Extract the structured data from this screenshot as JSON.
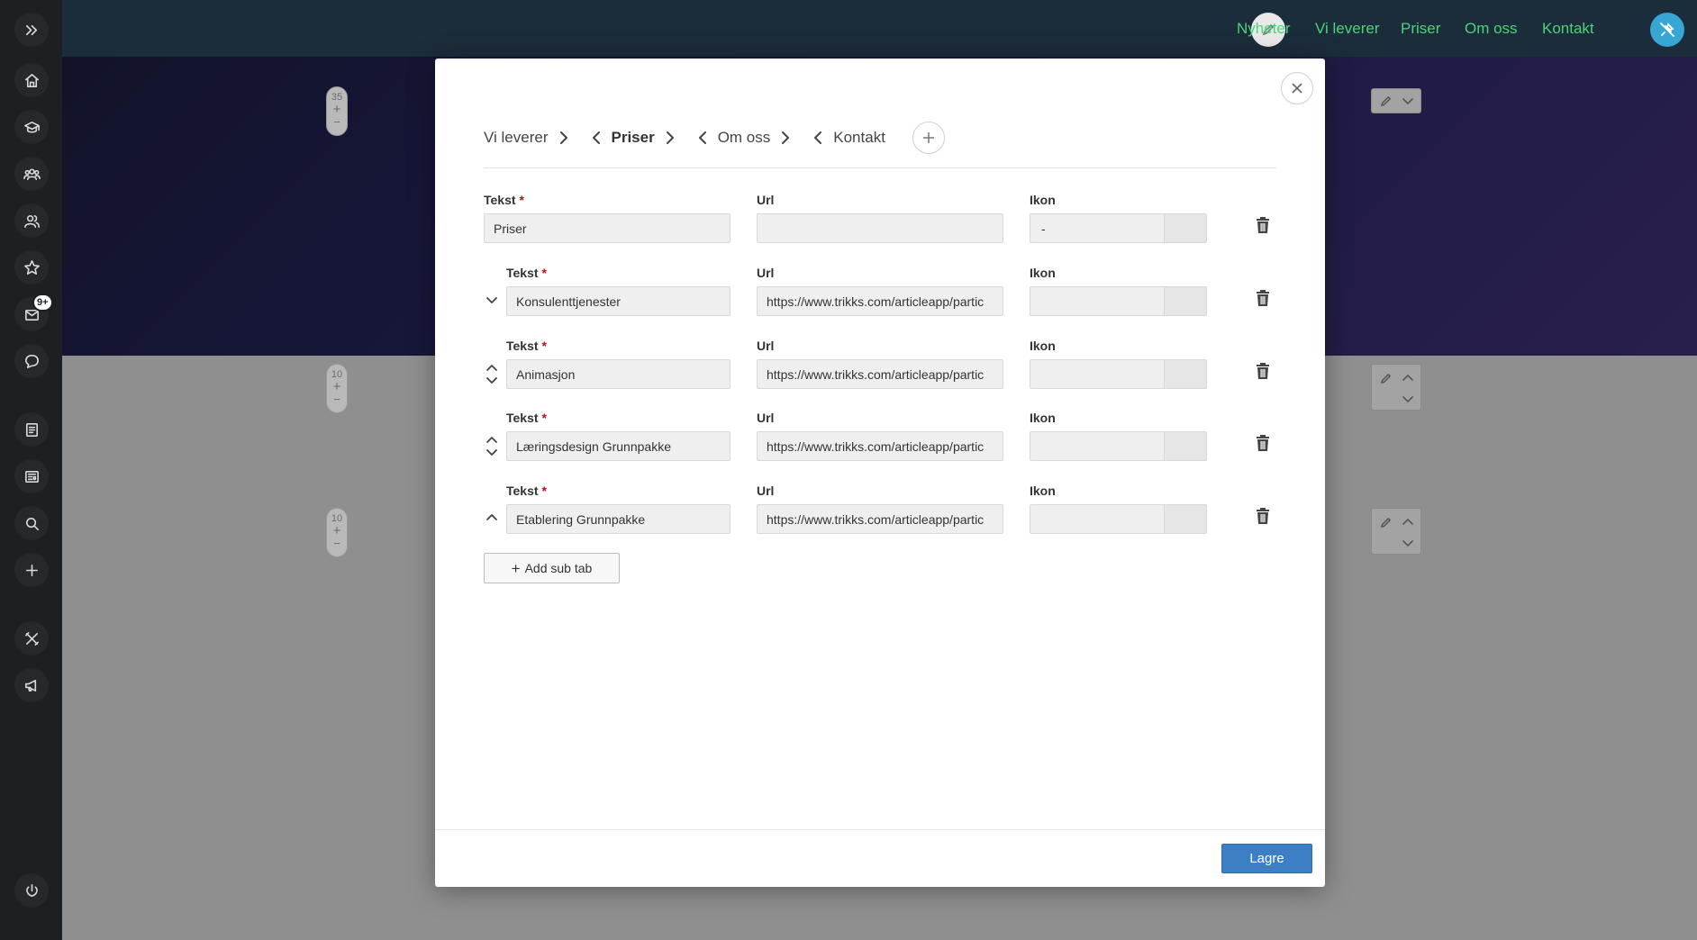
{
  "sidebar": {
    "icons": [
      "expand-icon",
      "home-icon",
      "graduation-cap-icon",
      "group-icon",
      "users-icon",
      "star-icon",
      "mail-icon",
      "chat-icon",
      "document-icon",
      "newspaper-icon",
      "search-icon",
      "plus-icon",
      "tools-icon",
      "megaphone-icon",
      "power-icon"
    ],
    "mail_badge": "9+"
  },
  "topbar": {
    "nav": [
      "Nyheter",
      "Vi leverer",
      "Priser",
      "Om oss",
      "Kontakt"
    ],
    "nav_color": "#4cd37a",
    "pin_color": "#37a6d4"
  },
  "background": {
    "row_controls": [
      {
        "value": "35",
        "plus": "+",
        "minus": "−"
      },
      {
        "value": "10",
        "plus": "+",
        "minus": "−"
      },
      {
        "value": "10",
        "plus": "+",
        "minus": "−"
      }
    ]
  },
  "modal": {
    "tabs": [
      {
        "label": "Vi leverer",
        "left_arrow": false,
        "right_arrow": true,
        "active": false
      },
      {
        "label": "Priser",
        "left_arrow": true,
        "right_arrow": true,
        "active": true
      },
      {
        "label": "Om oss",
        "left_arrow": true,
        "right_arrow": true,
        "active": false
      },
      {
        "label": "Kontakt",
        "left_arrow": true,
        "right_arrow": false,
        "active": false
      }
    ],
    "labels": {
      "text": "Tekst",
      "url": "Url",
      "icon": "Ikon",
      "required": "*"
    },
    "rows": [
      {
        "text": "Priser",
        "url": "",
        "icon": "-",
        "sub": false,
        "move_up": false,
        "move_down": false
      },
      {
        "text": "Konsulenttjenester",
        "url": "https://www.trikks.com/articleapp/partic",
        "icon": "",
        "sub": true,
        "move_up": false,
        "move_down": true
      },
      {
        "text": "Animasjon",
        "url": "https://www.trikks.com/articleapp/partic",
        "icon": "",
        "sub": true,
        "move_up": true,
        "move_down": true
      },
      {
        "text": "Læringsdesign Grunnpakke",
        "url": "https://www.trikks.com/articleapp/partic",
        "icon": "",
        "sub": true,
        "move_up": true,
        "move_down": true
      },
      {
        "text": "Etablering Grunnpakke",
        "url": "https://www.trikks.com/articleapp/partic",
        "icon": "",
        "sub": true,
        "move_up": true,
        "move_down": false
      }
    ],
    "add_sub_tab": {
      "plus": "+",
      "label": "Add sub tab"
    },
    "save_label": "Lagre",
    "save_color": "#3d7fc4"
  }
}
